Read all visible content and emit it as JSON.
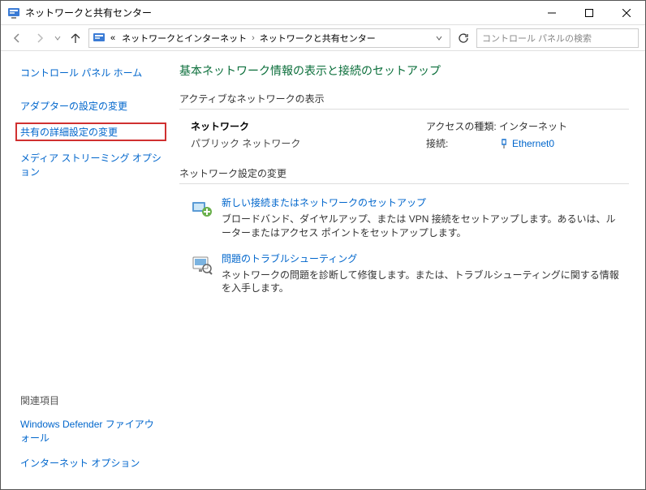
{
  "window": {
    "title": "ネットワークと共有センター"
  },
  "breadcrumb": {
    "prefix": "«",
    "items": [
      "ネットワークとインターネット",
      "ネットワークと共有センター"
    ]
  },
  "search": {
    "placeholder": "コントロール パネルの検索"
  },
  "sidebar": {
    "links": [
      "コントロール パネル ホーム",
      "アダプターの設定の変更",
      "共有の詳細設定の変更",
      "メディア ストリーミング オプション"
    ],
    "related_title": "関連項目",
    "related_links": [
      "Windows Defender ファイアウォール",
      "インターネット オプション"
    ]
  },
  "main": {
    "heading": "基本ネットワーク情報の表示と接続のセットアップ",
    "active_section_title": "アクティブなネットワークの表示",
    "network": {
      "name": "ネットワーク",
      "type": "パブリック ネットワーク",
      "access_label": "アクセスの種類:",
      "access_value": "インターネット",
      "conn_label": "接続:",
      "conn_value": "Ethernet0"
    },
    "change_section_title": "ネットワーク設定の変更",
    "change_items": [
      {
        "link": "新しい接続またはネットワークのセットアップ",
        "desc": "ブロードバンド、ダイヤルアップ、または VPN 接続をセットアップします。あるいは、ルーターまたはアクセス ポイントをセットアップします。"
      },
      {
        "link": "問題のトラブルシューティング",
        "desc": "ネットワークの問題を診断して修復します。または、トラブルシューティングに関する情報を入手します。"
      }
    ]
  }
}
